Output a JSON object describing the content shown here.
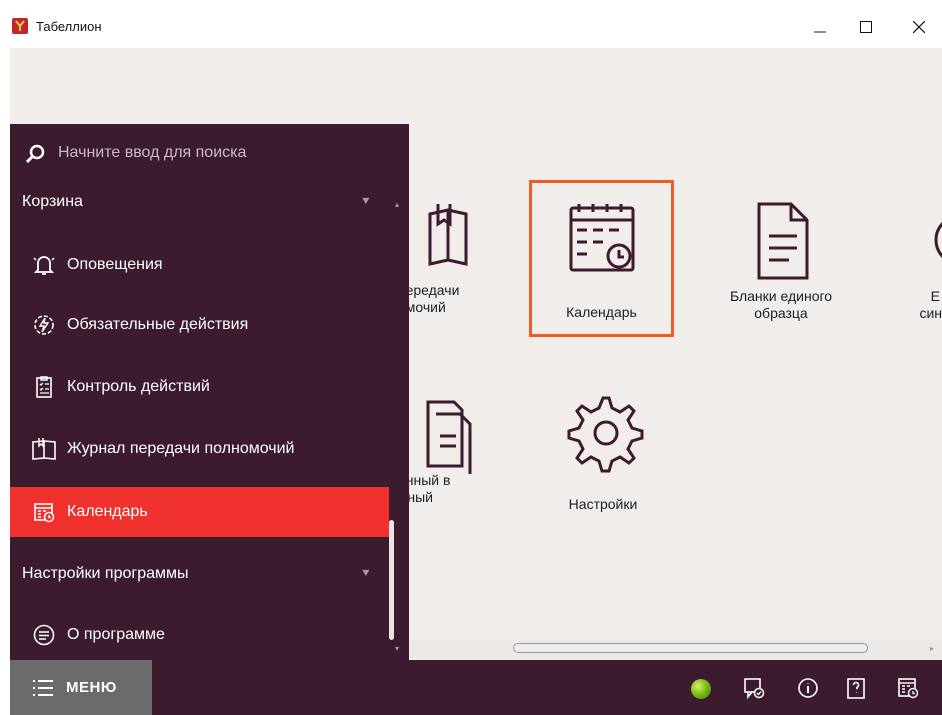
{
  "window": {
    "title": "Табеллион"
  },
  "menu": {
    "search_placeholder": "Начните ввод для поиска",
    "sections": [
      {
        "label": "Корзина"
      },
      {
        "label": "Настройки программы"
      }
    ],
    "items": [
      {
        "label": "Оповещения",
        "icon": "bell-icon"
      },
      {
        "label": "Обязательные действия",
        "icon": "required-actions-icon"
      },
      {
        "label": "Контроль действий",
        "icon": "checklist-icon"
      },
      {
        "label": "Журнал передачи полномочий",
        "icon": "book-icon"
      },
      {
        "label": "Календарь",
        "icon": "calendar-icon",
        "active": true
      },
      {
        "label": "О программе",
        "icon": "about-icon"
      }
    ],
    "button_label": "МЕНЮ"
  },
  "tiles": [
    {
      "line1": "передачи",
      "line2": "омочий",
      "icon": "book-icon"
    },
    {
      "line1": "Календарь",
      "line2": "",
      "icon": "calendar-icon",
      "highlighted": true
    },
    {
      "line1": "Бланки единого",
      "line2": "образца",
      "icon": "document-icon"
    },
    {
      "line1": "Е",
      "line2": "син",
      "icon": "partial-icon"
    },
    {
      "line1": "онный в",
      "line2": "жный",
      "icon": "documents-icon"
    },
    {
      "line1": "Настройки",
      "line2": "",
      "icon": "gear-icon"
    }
  ],
  "status": {
    "connection_color": "#7bbf1a"
  },
  "colors": {
    "menu_bg": "#3c1b2e",
    "active_item": "#f0312d",
    "highlight_border": "#ef5c24",
    "content_bg": "#f1edeb"
  }
}
